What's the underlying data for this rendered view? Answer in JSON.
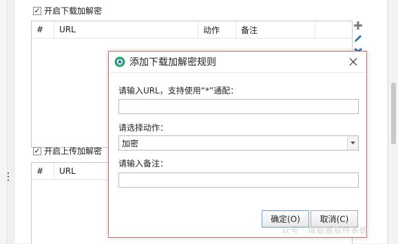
{
  "download_section": {
    "checkbox_checked": true,
    "checkbox_label": "开启下载加解密",
    "columns": [
      "#",
      "URL",
      "动作",
      "备注",
      ""
    ]
  },
  "upload_section": {
    "checkbox_checked": true,
    "checkbox_label": "开启上传加解密",
    "columns": [
      "#",
      "URL",
      "",
      "",
      ""
    ]
  },
  "toolbar": {
    "add_icon": "plus-icon",
    "edit_icon": "pencil-icon",
    "delete_icon": "delete-x-icon"
  },
  "dialog": {
    "title": "添加下载加解密规则",
    "url_label": "请输入URL，支持使用“*”通配：",
    "url_value": "",
    "action_label": "请选择动作：",
    "action_value": "加密",
    "note_label": "请输入备注：",
    "note_value": "",
    "ok_label": "确定(O)",
    "cancel_label": "取消(C)"
  },
  "watermark": "众号 · 域智盾软件系统",
  "colors": {
    "dialog_border": "#d56a6a",
    "plus_icon": "#7a7a7a",
    "pencil_icon": "#2a6ebb",
    "delete_icon": "#2a6ebb",
    "logo_green": "#2aa36a"
  }
}
